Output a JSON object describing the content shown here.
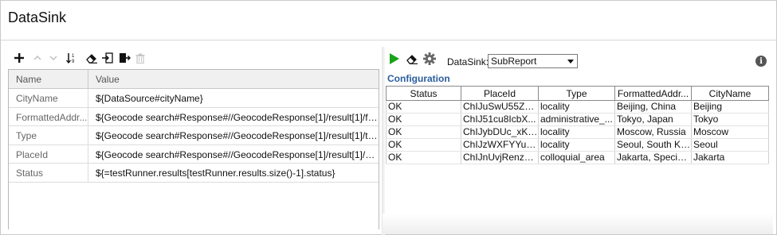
{
  "window": {
    "title": "DataSink"
  },
  "left_toolbar": {
    "buttons": [
      {
        "icon": "plus-icon",
        "enabled": true
      },
      {
        "icon": "chevron-up-icon",
        "enabled": false
      },
      {
        "icon": "chevron-down-icon",
        "enabled": false
      },
      {
        "icon": "sort-icon",
        "enabled": true
      },
      {
        "icon": "eraser-icon",
        "enabled": true
      },
      {
        "icon": "import-icon",
        "enabled": true
      },
      {
        "icon": "export-icon",
        "enabled": true
      },
      {
        "icon": "trash-icon",
        "enabled": false
      }
    ]
  },
  "properties": {
    "headers": {
      "name": "Name",
      "value": "Value"
    },
    "rows": [
      {
        "name": "CityName",
        "value": "${DataSource#cityName}"
      },
      {
        "name": "FormattedAddr...",
        "value": "${Geocode search#Response#//GeocodeResponse[1]/result[1]/fo..."
      },
      {
        "name": "Type",
        "value": "${Geocode search#Response#//GeocodeResponse[1]/result[1]/ty..."
      },
      {
        "name": "PlaceId",
        "value": "${Geocode search#Response#//GeocodeResponse[1]/result[1]/pl..."
      },
      {
        "name": "Status",
        "value": "${=testRunner.results[testRunner.results.size()-1].status}"
      }
    ]
  },
  "right_toolbar": {
    "run_icon": "play-icon",
    "clear_icon": "eraser-icon",
    "settings_icon": "gear-icon",
    "datasink_label": "DataSink:",
    "datasink_selected": "SubReport",
    "info_icon": "info-icon",
    "info_glyph": "i"
  },
  "configuration": {
    "label": "Configuration",
    "columns": [
      "Status",
      "PlaceId",
      "Type",
      "FormattedAddr...",
      "CityName"
    ],
    "rows": [
      [
        "OK",
        "ChIJuSwU55ZS8...",
        "locality",
        "Beijing, China",
        "Beijing"
      ],
      [
        "OK",
        "ChIJ51cu8IcbX...",
        "administrative_...",
        "Tokyo, Japan",
        "Tokyo"
      ],
      [
        "OK",
        "ChIJybDUc_xKt...",
        "locality",
        "Moscow, Russia",
        "Moscow"
      ],
      [
        "OK",
        "ChIJzWXFYYuif...",
        "locality",
        "Seoul, South Ko...",
        "Seoul"
      ],
      [
        "OK",
        "ChIJnUvjRenzaS...",
        "colloquial_area",
        "Jakarta, Special ...",
        "Jakarta"
      ]
    ]
  },
  "colors": {
    "play_green": "#1aa31a",
    "config_blue": "#2a5d9e",
    "disabled_gray": "#c6c6c6"
  }
}
